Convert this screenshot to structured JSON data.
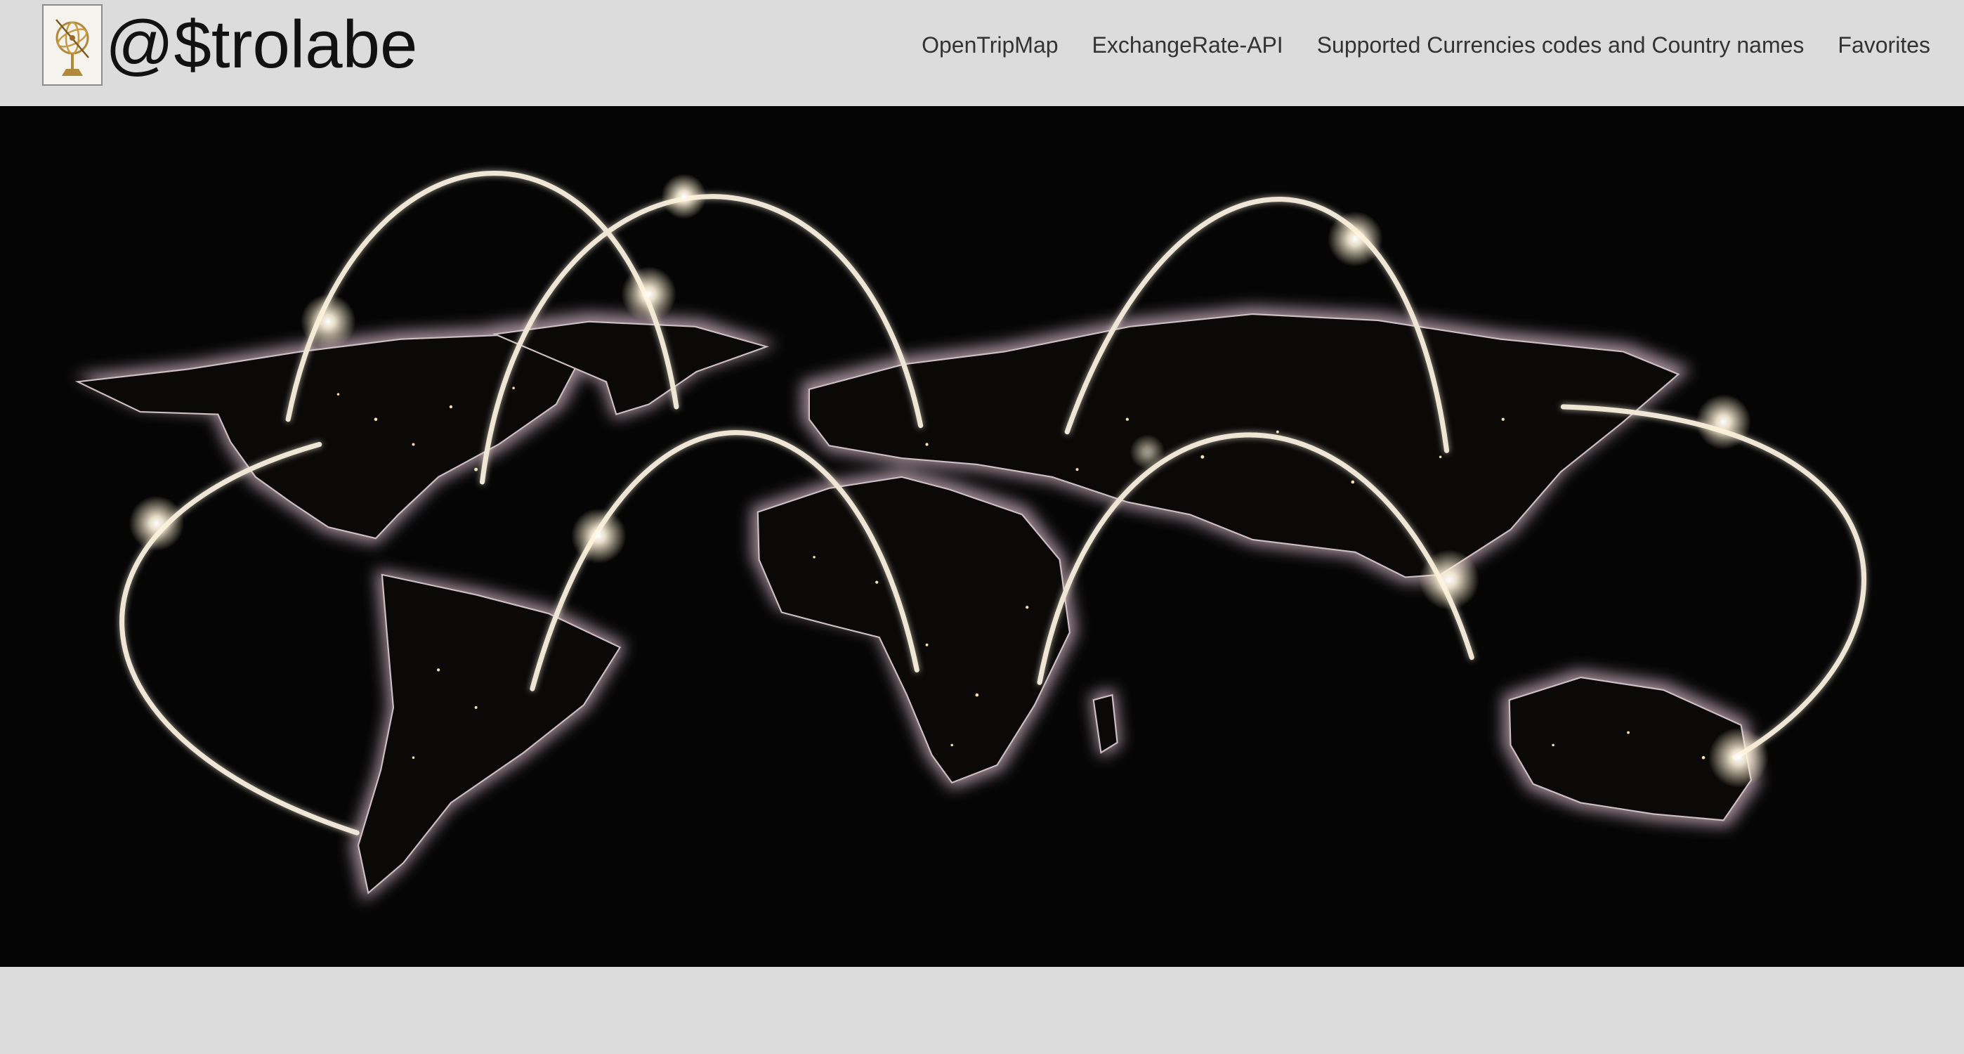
{
  "brand": {
    "name": "@$trolabe",
    "logo_icon": "armillary-sphere-icon"
  },
  "nav": {
    "items": [
      {
        "label": "OpenTripMap"
      },
      {
        "label": "ExchangeRate-API"
      },
      {
        "label": "Supported Currencies codes and Country names"
      },
      {
        "label": "Favorites"
      }
    ]
  },
  "hero": {
    "image": "world-map-night-connections-image"
  },
  "colors": {
    "nav_background": "#dcdcdc",
    "hero_background": "#050505",
    "land_glow": "#bfaab4",
    "arc_color": "#efe6d6"
  }
}
